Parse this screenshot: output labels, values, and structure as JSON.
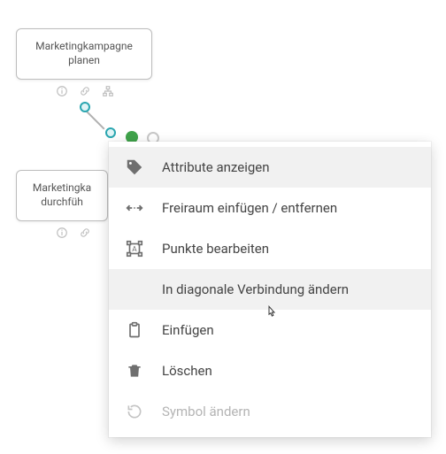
{
  "nodes": {
    "plan": "Marketingkampagne planen",
    "exec": "Marketingka durchfüh"
  },
  "menu": {
    "attributes": "Attribute anzeigen",
    "freespace": "Freiraum einfügen / entfernen",
    "points": "Punkte bearbeiten",
    "diagonal": "In diagonale Verbindung ändern",
    "paste": "Einfügen",
    "delete": "Löschen",
    "symbol": "Symbol ändern"
  }
}
